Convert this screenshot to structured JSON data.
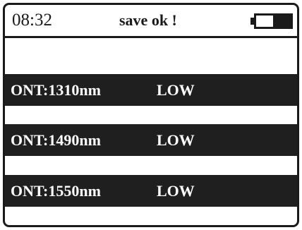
{
  "status_bar": {
    "time": "08:32",
    "message": "save ok !",
    "battery": {
      "level": 0.5,
      "color": "#1a1a1a"
    }
  },
  "readings": [
    {
      "label": "ONT:1310nm",
      "status": "LOW"
    },
    {
      "label": "ONT:1490nm",
      "status": "LOW"
    },
    {
      "label": "ONT:1550nm",
      "status": "LOW"
    }
  ],
  "colors": {
    "foreground": "#1a1a1a",
    "row_background": "#1f1f1f",
    "row_text": "#ffffff",
    "background": "#ffffff"
  }
}
